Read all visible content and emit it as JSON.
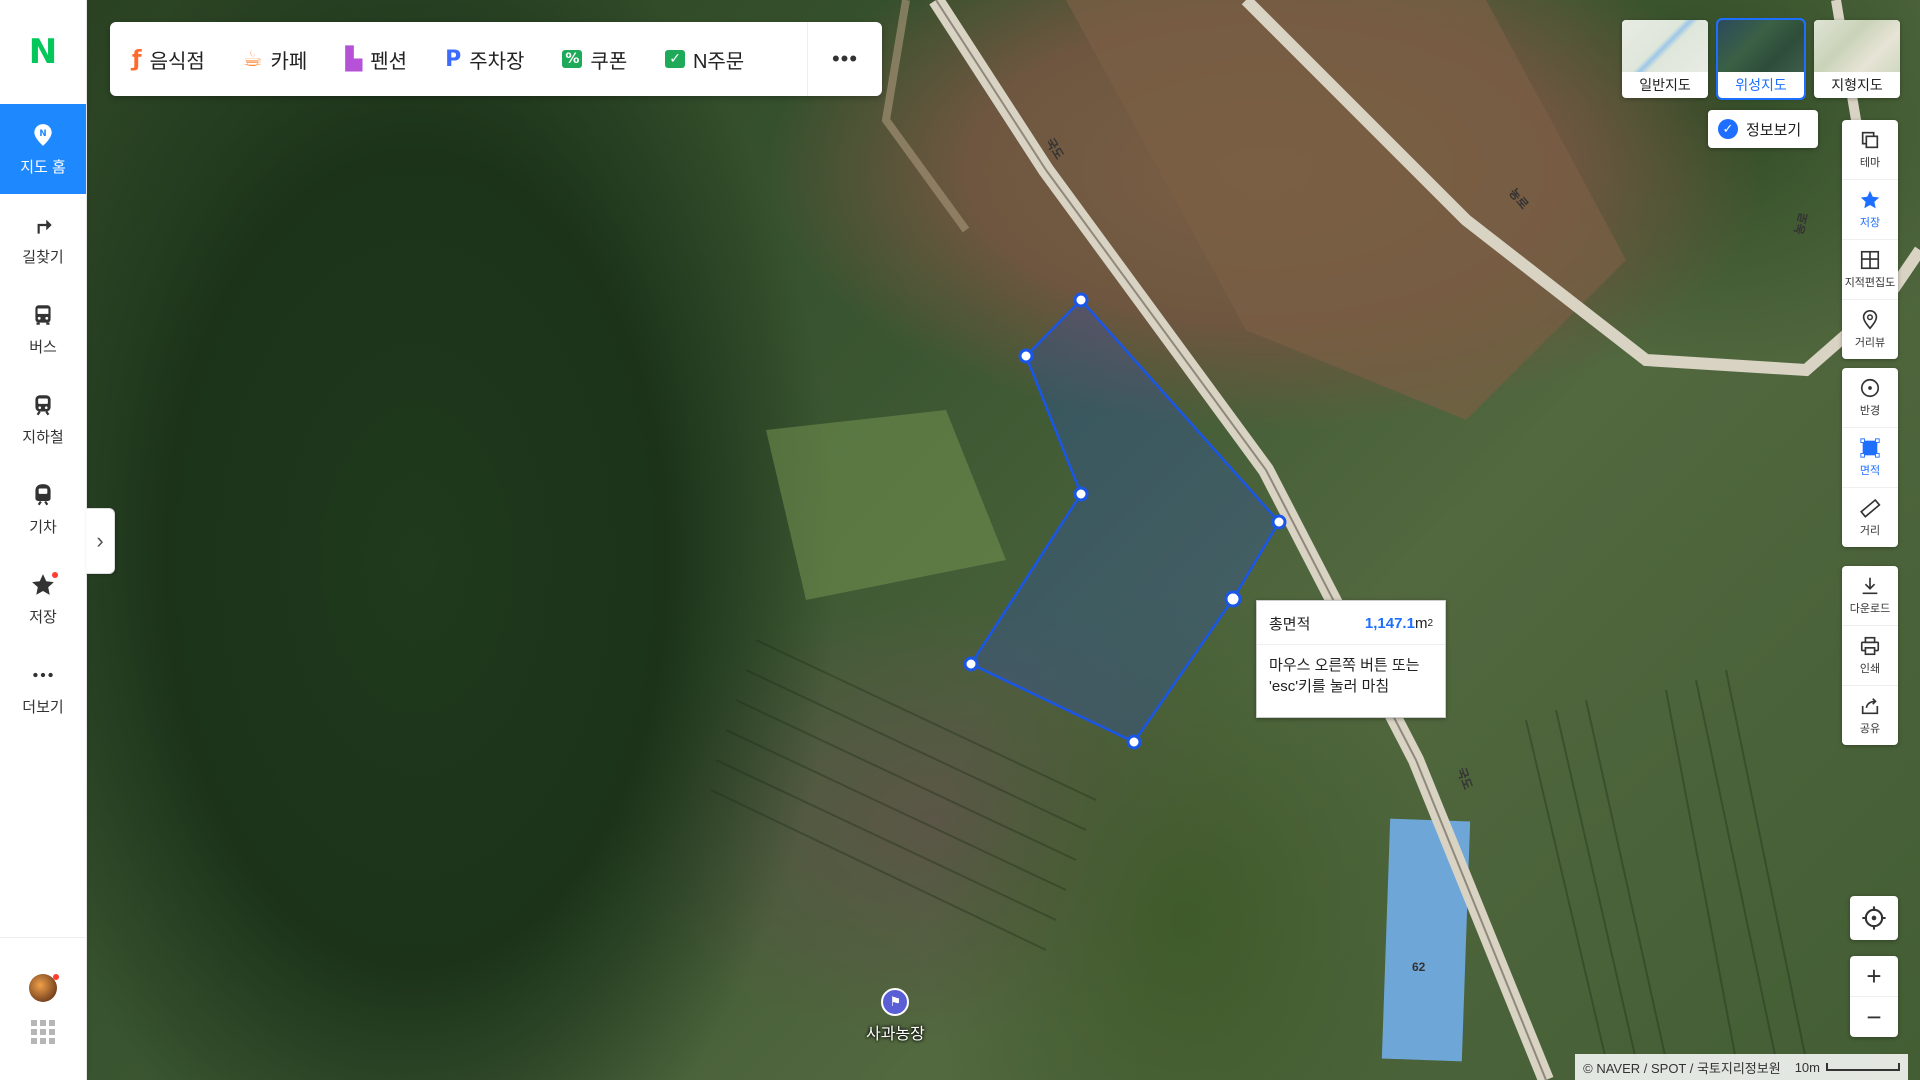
{
  "sidebar": {
    "logo": "N",
    "items": [
      {
        "label": "지도 홈",
        "icon": "map-home-icon",
        "active": true
      },
      {
        "label": "길찾기",
        "icon": "directions-icon"
      },
      {
        "label": "버스",
        "icon": "bus-icon"
      },
      {
        "label": "지하철",
        "icon": "subway-icon"
      },
      {
        "label": "기차",
        "icon": "train-icon"
      },
      {
        "label": "저장",
        "icon": "star-icon",
        "badge": true
      },
      {
        "label": "더보기",
        "icon": "more-icon"
      }
    ]
  },
  "categories": [
    {
      "label": "음식점",
      "icon": "fork-knife-icon",
      "color": "#ff6b2c"
    },
    {
      "label": "카페",
      "icon": "cup-icon",
      "color": "#ff8a3d"
    },
    {
      "label": "펜션",
      "icon": "bed-icon",
      "color": "#b552d8"
    },
    {
      "label": "주차장",
      "icon": "parking-icon",
      "color": "#3d6bff"
    },
    {
      "label": "쿠폰",
      "icon": "coupon-icon",
      "color": "#1faa59"
    },
    {
      "label": "N주문",
      "icon": "order-icon",
      "color": "#1faa59"
    }
  ],
  "map_types": [
    {
      "label": "일반지도",
      "active": false
    },
    {
      "label": "위성지도",
      "active": true
    },
    {
      "label": "지형지도",
      "active": false
    }
  ],
  "info_view": {
    "label": "정보보기",
    "checked": true
  },
  "tools_group1": [
    {
      "label": "테마",
      "icon": "theme-icon"
    },
    {
      "label": "저장",
      "icon": "star-icon",
      "active": true
    },
    {
      "label": "지적편집도",
      "icon": "cadastral-icon"
    },
    {
      "label": "거리뷰",
      "icon": "streetview-icon"
    }
  ],
  "tools_group2": [
    {
      "label": "반경",
      "icon": "radius-icon"
    },
    {
      "label": "면적",
      "icon": "area-icon",
      "active": true
    },
    {
      "label": "거리",
      "icon": "ruler-icon"
    }
  ],
  "tools_group3": [
    {
      "label": "다운로드",
      "icon": "download-icon"
    },
    {
      "label": "인쇄",
      "icon": "print-icon"
    },
    {
      "label": "공유",
      "icon": "share-icon"
    }
  ],
  "popup": {
    "label": "총면적",
    "value": "1,147.1",
    "unit": "m",
    "unit_sup": "2",
    "hint_line1": "마우스 오른쪽 버튼 또는",
    "hint_line2": "'esc'키를 눌러 마침"
  },
  "poi": {
    "label": "사과농장"
  },
  "road_labels": [
    "국도",
    "국도",
    "농로",
    "농로",
    "62"
  ],
  "copyright": "© NAVER / SPOT / 국토지리정보원",
  "scale": "10m",
  "colors": {
    "accent": "#1e89ff",
    "naver_green": "#03c75a",
    "measure_line": "#1a56e8"
  }
}
